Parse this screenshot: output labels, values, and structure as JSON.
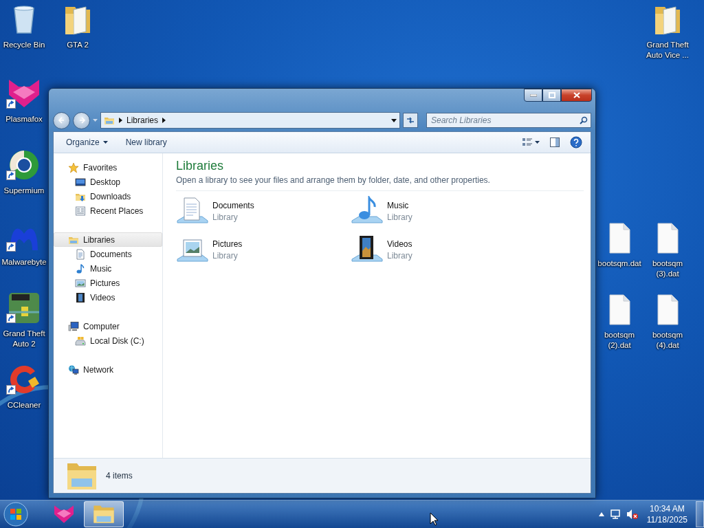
{
  "desktop": {
    "icons": [
      {
        "label": "Recycle Bin",
        "kind": "recycle",
        "shortcut": false
      },
      {
        "label": "GTA 2",
        "kind": "folder",
        "shortcut": false
      },
      {
        "label": "Plasmafox",
        "kind": "plasmafox",
        "shortcut": true
      },
      {
        "label": "Supermium",
        "kind": "browser",
        "shortcut": true
      },
      {
        "label": "Malwarebyte",
        "kind": "malware",
        "shortcut": true
      },
      {
        "label": "Grand Theft Auto 2",
        "kind": "game",
        "shortcut": true
      },
      {
        "label": "CCleaner",
        "kind": "cleaner",
        "shortcut": true
      },
      {
        "label": "Grand Theft Auto Vice ...",
        "kind": "folder",
        "shortcut": false
      },
      {
        "label": "bootsqm.dat",
        "kind": "file",
        "shortcut": false
      },
      {
        "label": "bootsqm (3).dat",
        "kind": "file",
        "shortcut": false
      },
      {
        "label": "bootsqm (2).dat",
        "kind": "file",
        "shortcut": false
      },
      {
        "label": "bootsqm (4).dat",
        "kind": "file",
        "shortcut": false
      }
    ]
  },
  "window": {
    "address": {
      "breadcrumb": "Libraries"
    },
    "search": {
      "placeholder": "Search Libraries"
    },
    "toolbar": {
      "buttons": [
        {
          "label": "Organize",
          "dropdown": true
        },
        {
          "label": "New library",
          "dropdown": false
        }
      ]
    },
    "nav_pane": [
      {
        "label": "Favorites",
        "kind": "star",
        "selected": false,
        "children": [
          {
            "label": "Desktop",
            "kind": "desktop",
            "selected": false
          },
          {
            "label": "Downloads",
            "kind": "downloads",
            "selected": false
          },
          {
            "label": "Recent Places",
            "kind": "recent",
            "selected": false
          }
        ]
      },
      {
        "label": "Libraries",
        "kind": "library",
        "selected": true,
        "children": [
          {
            "label": "Documents",
            "kind": "documents",
            "selected": false
          },
          {
            "label": "Music",
            "kind": "music",
            "selected": false
          },
          {
            "label": "Pictures",
            "kind": "pictures",
            "selected": false
          },
          {
            "label": "Videos",
            "kind": "videos",
            "selected": false
          }
        ]
      },
      {
        "label": "Computer",
        "kind": "computer",
        "selected": false,
        "children": [
          {
            "label": "Local Disk (C:)",
            "kind": "disk",
            "selected": false
          }
        ]
      },
      {
        "label": "Network",
        "kind": "network",
        "selected": false
      }
    ],
    "content": {
      "title": "Libraries",
      "description": "Open a library to see your files and arrange them by folder, date, and other properties.",
      "items": [
        {
          "name": "Documents",
          "subtitle": "Library",
          "kind": "documents"
        },
        {
          "name": "Music",
          "subtitle": "Library",
          "kind": "music"
        },
        {
          "name": "Pictures",
          "subtitle": "Library",
          "kind": "pictures"
        },
        {
          "name": "Videos",
          "subtitle": "Library",
          "kind": "videos"
        }
      ]
    },
    "status_bar": {
      "text": "4 items"
    }
  },
  "taskbar": {
    "buttons": [
      {
        "kind": "plasmafox",
        "selected": false
      },
      {
        "kind": "explorer",
        "selected": true
      }
    ],
    "clock": {
      "time": "10:34 AM",
      "date": "11/18/2025"
    }
  }
}
